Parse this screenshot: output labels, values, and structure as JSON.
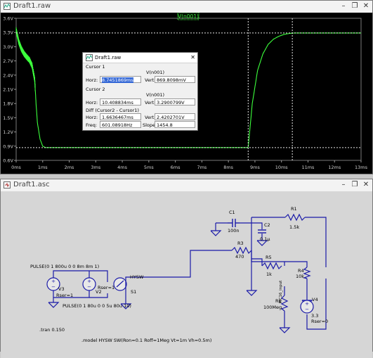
{
  "plot_window": {
    "title": "Draft1.raw",
    "trace_label": "V(n001)",
    "y_ticks": [
      "3.6V",
      "3.3V",
      "3.0V",
      "2.7V",
      "2.4V",
      "2.1V",
      "1.8V",
      "1.5V",
      "1.2V",
      "0.9V",
      "0.6V"
    ],
    "x_ticks": [
      "0ms",
      "1ms",
      "2ms",
      "3ms",
      "4ms",
      "5ms",
      "6ms",
      "7ms",
      "8ms",
      "9ms",
      "10ms",
      "11ms",
      "12ms",
      "13ms"
    ],
    "trace_color": "#3cff3c"
  },
  "chart_data": {
    "type": "line",
    "title": "",
    "xlabel": "",
    "ylabel": "",
    "xlim": [
      0,
      13
    ],
    "ylim": [
      0.6,
      3.6
    ],
    "series": [
      {
        "name": "V(n001)",
        "x": [
          0,
          0.1,
          0.2,
          0.3,
          0.4,
          0.5,
          0.6,
          0.7,
          0.75,
          0.8,
          0.9,
          1.0,
          1.1,
          1.2,
          8.74,
          8.75,
          8.9,
          9.1,
          9.3,
          9.5,
          9.7,
          9.9,
          10.1,
          10.3,
          10.5,
          10.7,
          11.0,
          13.0
        ],
        "y": [
          3.35,
          3.1,
          2.95,
          2.85,
          2.78,
          2.72,
          2.6,
          2.3,
          1.8,
          1.4,
          1.05,
          0.9,
          0.87,
          0.87,
          0.87,
          0.9,
          1.8,
          2.5,
          2.85,
          3.05,
          3.16,
          3.22,
          3.26,
          3.28,
          3.29,
          3.29,
          3.29,
          3.29
        ]
      }
    ],
    "cursors": [
      {
        "name": "Cursor 1",
        "x_ms": 8.7451869,
        "y_v": 0.8698098
      },
      {
        "name": "Cursor 2",
        "x_ms": 10.408834,
        "y_v": 3.2900799
      }
    ]
  },
  "cursor_dialog": {
    "title": "Draft1.raw",
    "cursor1_label": "Cursor 1",
    "cursor1_trace": "V(n001)",
    "cursor1_horz_label": "Horz:",
    "cursor1_horz": "8.7451869ms",
    "cursor1_vert_label": "Vert:",
    "cursor1_vert": "869.8098mV",
    "cursor2_label": "Cursor 2",
    "cursor2_trace": "V(n001)",
    "cursor2_horz_label": "Horz:",
    "cursor2_horz": "10.408834ms",
    "cursor2_vert_label": "Vert:",
    "cursor2_vert": "3.2900799V",
    "diff_label": "Diff (Cursor2 - Cursor1)",
    "diff_horz_label": "Horz:",
    "diff_horz": "1.6636467ms",
    "diff_vert_label": "Vert:",
    "diff_vert": "2.4202701V",
    "freq_label": "Freq:",
    "freq": "601.08918Hz",
    "slope_label": "Slope:",
    "slope": "1454.8"
  },
  "schematic_window": {
    "title": "Draft1.asc",
    "pulse1": "PULSE(0 1 800u 0 0 8m 8m 1)",
    "pulse2": "PULSE(0 1 80u 0 0 5u 80u 10)",
    "v3_name": "V3",
    "v3_param": "Rser=1",
    "v2_name": "V2",
    "v2_param": "Rser=1",
    "s1_model": "HYSW",
    "s1_name": "S1",
    "c1_name": "C1",
    "c1_value": "100n",
    "c2_name": "C2",
    "c2_value": "0.1µ",
    "r1_name": "R1",
    "r1_value": "1.5k",
    "r3_name": "R3",
    "r3_value": "470",
    "r5_name": "R5",
    "r5_value": "1k",
    "r4_name": "R4",
    "r4_value": "10k",
    "r6_name": "R6",
    "r6_value": "100Meg",
    "r6_net": "PIC16_input",
    "v4_name": "V4",
    "v4_value": "3.3",
    "v4_param": "Rser=0",
    "tran_directive": ".tran 0.150",
    "model_directive": ".model HYSW SW(Ron=0.1 Roff=1Meg Vt=1m Vh=0.5m)"
  }
}
